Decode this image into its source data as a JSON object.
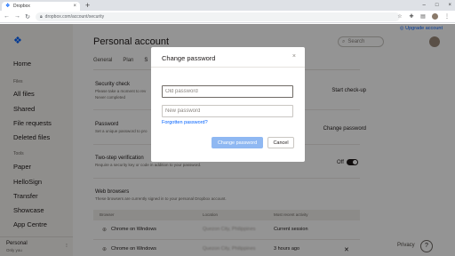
{
  "browser": {
    "tab_title": "Dropbox",
    "url": "dropbox.com/account/security",
    "new_tab": "+",
    "close_tab": "×",
    "window_controls": [
      "–",
      "□",
      "×"
    ]
  },
  "sidebar": {
    "items_top": [
      {
        "label": "Home"
      }
    ],
    "files_heading": "Files",
    "file_items": [
      {
        "label": "All files"
      },
      {
        "label": "Shared"
      },
      {
        "label": "File requests"
      },
      {
        "label": "Deleted files"
      }
    ],
    "tools_heading": "Tools",
    "tool_items": [
      {
        "label": "Paper"
      },
      {
        "label": "HelloSign"
      },
      {
        "label": "Transfer"
      },
      {
        "label": "Showcase"
      },
      {
        "label": "App Centre"
      }
    ],
    "account_name": "Personal",
    "account_sub": "Only you"
  },
  "header": {
    "upgrade": "Upgrade account",
    "title": "Personal account",
    "search_placeholder": "Search"
  },
  "tabs": [
    {
      "label": "General"
    },
    {
      "label": "Plan"
    },
    {
      "label": "S"
    }
  ],
  "sections": {
    "security_check": {
      "title": "Security check",
      "desc_1": "Please take a moment to rev",
      "desc_2": "Never completed",
      "action": "Start check-up"
    },
    "password": {
      "title": "Password",
      "desc": "Set a unique password to pro",
      "action": "Change password"
    },
    "two_step": {
      "title": "Two-step verification",
      "desc": "Require a security key or code in addition to your password.",
      "toggle_label": "Off",
      "enabled": false
    },
    "web_browsers": {
      "title": "Web browsers",
      "desc": "These browsers are currently signed in to your personal Dropbox account."
    }
  },
  "table": {
    "headers": [
      "Browser",
      "Location",
      "Most recent activity"
    ],
    "rows": [
      {
        "browser": "Chrome on Windows",
        "location": "Quezon City, Philippines",
        "activity": "Current session"
      },
      {
        "browser": "Chrome on Windows",
        "location": "Quezon City, Philippines",
        "activity": "3 hours ago"
      }
    ]
  },
  "footer": {
    "privacy": "Privacy",
    "help": "?"
  },
  "modal": {
    "title": "Change password",
    "close": "×",
    "old_password_placeholder": "Old password",
    "new_password_placeholder": "New password",
    "forgot": "Forgotten password?",
    "submit": "Change password",
    "cancel": "Cancel"
  },
  "colors": {
    "accent": "#0061fe",
    "sidebar_bg": "#f7f5f2",
    "button_disabled": "#8fb8f2"
  }
}
